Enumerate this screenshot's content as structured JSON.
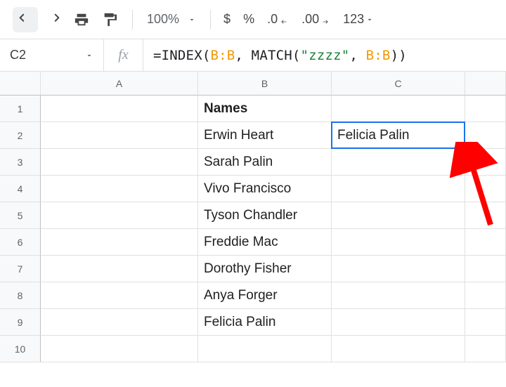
{
  "toolbar": {
    "zoom": "100%",
    "currency": "$",
    "percent": "%",
    "dec_dec": ".0",
    "dec_inc": ".00",
    "more_formats": "123"
  },
  "formula_bar": {
    "cell_ref": "C2",
    "fx_label": "fx",
    "formula_prefix": "=INDEX(",
    "formula_col1": "B:B",
    "formula_mid1": ", MATCH(",
    "formula_str": "\"zzzz\"",
    "formula_mid2": ", ",
    "formula_col2": "B:B",
    "formula_suffix": "))"
  },
  "columns": {
    "a": "A",
    "b": "B",
    "c": "C"
  },
  "rows": [
    "1",
    "2",
    "3",
    "4",
    "5",
    "6",
    "7",
    "8",
    "9",
    "10"
  ],
  "cells": {
    "b1": "Names",
    "b2": "Erwin Heart",
    "b3": "Sarah Palin",
    "b4": "Vivo Francisco",
    "b5": "Tyson Chandler",
    "b6": "Freddie Mac",
    "b7": "Dorothy Fisher",
    "b8": "Anya Forger",
    "b9": "Felicia Palin",
    "c2": "Felicia Palin"
  },
  "annotation": {
    "arrow_color": "#ff0000"
  }
}
